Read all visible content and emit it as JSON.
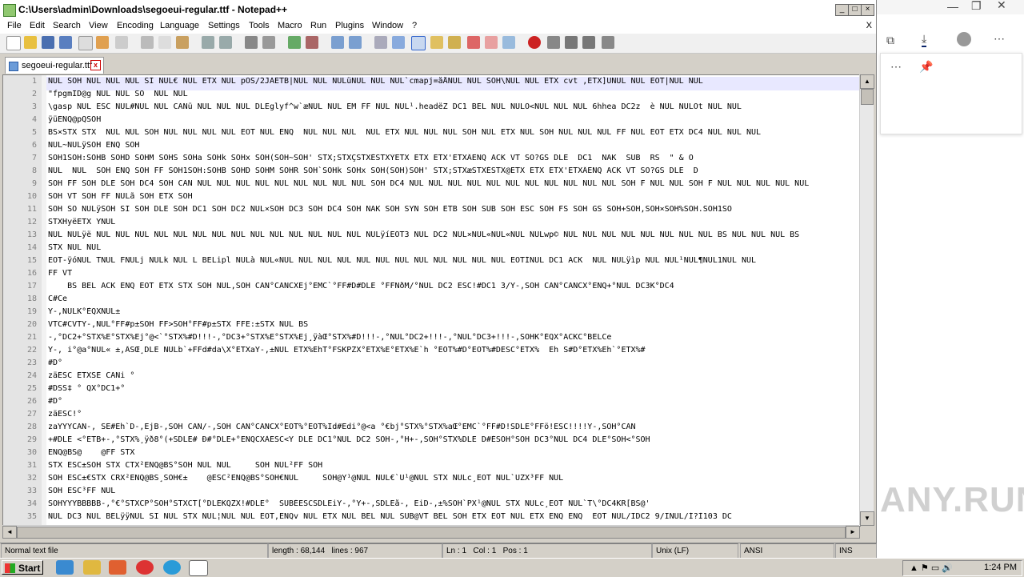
{
  "window": {
    "title": "C:\\Users\\admin\\Downloads\\segoeui-regular.ttf - Notepad++",
    "close_doc": "X"
  },
  "menu": [
    "File",
    "Edit",
    "Search",
    "View",
    "Encoding",
    "Language",
    "Settings",
    "Tools",
    "Macro",
    "Run",
    "Plugins",
    "Window",
    "?"
  ],
  "tab": {
    "label": "segoeui-regular.ttf",
    "close": "x"
  },
  "editor": {
    "line_numbers": [
      "1",
      "2",
      "3",
      "4",
      "5",
      "6",
      "7",
      "8",
      "9",
      "10",
      "11",
      "12",
      "13",
      "14",
      "15",
      "16",
      "17",
      "18",
      "19",
      "20",
      "21",
      "22",
      "23",
      "24",
      "25",
      "26",
      "27",
      "28",
      "29",
      "30",
      "31",
      "32",
      "33",
      "34",
      "35"
    ],
    "lines": [
      "NUL SOH NUL NUL NUL SI NUL€ NUL ETX NUL pOS/2JAETB|NUL NUL NULüNUL NUL NUL`cmapj=åÅNUL NUL SOH\\NUL NUL ETX cvt ,ETX]ÜNUL NUL EOT|NUL NUL",
      "\"fpgmID@g NUL NUL SO  NUL NUL",
      "\\gasp NUL ESC NUL#NUL NUL CANü NUL NUL NUL DLEglyf^w`æNUL NUL EM FF NUL NUL¹.headëZ DC1 BEL NUL NULÓ<NUL NUL NUL 6hhea DC2z  è NUL NULÒt NUL NUL",
      "ÿüENQ@pQSOH",
      "BS×STX STX  NUL NUL SOH NUL NUL NUL NUL EOT NUL ENQ  NUL NUL NUL  NUL ETX NUL NUL NUL SOH NUL ETX NUL SOH NUL NUL NUL FF NUL EOT ETX DC4 NUL NUL NUL",
      "NUL~NULÿSOH ENQ SOH",
      "SOH1SOH:SOHB SOHD SOHM SOHS SOHa SOHk SOHx SOH(SOH~SOH' STX;STXÇSTXÉSTXÝETX ETX ETX'ETXÂENQ ACK VT SO?GS DLE  DC1  NAK  SUB  RS  \" & O",
      "NUL  NUL  SOH ENQ SOH FF SOH1SOH:SOHB SOHD SOHM SOHR SOH`SOHk SOHx SOH(SOH)SOH' STX;STXæSTXÉSTX@ETX ETX ETX'ETXÂENQ ACK VT SO?GS DLE  D",
      "SOH FF SOH DLE SOH DC4 SOH CAN NUL NUL NUL NUL NUL NUL NUL NUL NUL SOH DC4 NUL NUL NUL NUL NUL NUL NUL NUL NUL NUL NUL SOH F NUL NUL SOH F NUL NUL NUL NUL NUL",
      "SOH VT SOH FF NULã SOH ETX SOH",
      "SOH SO NULÿSOH SI SOH DLE SOH DC1 SOH DC2 NUL×SOH DC3 SOH DC4 SOH NAK SOH SYN SOH ETB SOH SUB SOH ESC SOH FS SOH GS SOH+SOH,SOH×SOH%SOH.SOH1SO",
      "STXHyëETX YNUL",
      "NUL NULÿë NUL NUL NUL NUL NUL NUL NUL NUL NUL NUL NUL NUL NUL NUL NULÿíEOT3 NUL DC2 NUL×NUL«NUL«NUL NULwp© NUL NUL NUL NUL NUL NUL NUL NUL BS NUL NUL NUL BS",
      "STX NUL NUL",
      "EOT-ÿóNUL TNUL FNULj NULk NUL L BELipl NULà NUL«NUL NUL NUL NUL NUL NUL NUL NUL NUL NUL NUL NUL EOTÍNUL DC1 ACK  NUL NULÿìp NUL NUL¹NUL¶NUL1NUL NUL",
      "FF VT",
      "    BS BEL ACK ENQ EOT ETX STX SOH NUL,SOH CAN°CANCXEj°EMC`°FF#D#DLE °FFNðM/°NUL DC2 ESC!#DC1 3/Y-,SOH CAN°CANCX°ENQ+°NUL DC3K°DC4",
      "C#Ce",
      "Y-,NULK°ÈQXNUL±",
      "VTC#CVTY-,NUL°FF#p±SOH FF>SOH°FF#p±STX FFE:±STX NUL BS",
      "-,°DC2+°STX%E°STX%Ej°@<`°STX%#D!!!-,°DC3+°STX%E°STX%Ej¸ÿàŒ°STX%#D!!!-,°NUL°DC2+!!!-,°NUL°DC3+!!!-,SOHK°ÈQX°ACKC°BELCe",
      "Y-, i°@a°NUL« ±,ÂŠŒ¸DLE NULb`+FFd#da\\X°ETXaY-,±NUL ETX%EhT°FSKPZX°ETX%E°ETX%E`h °EOT%#D°EOT%#DESC°ETX%  Eh Š#D°ETX%Eh`°ETX%#",
      "#D°",
      "zäESC ETXŠE CANi °",
      "#DŠŠ‡ ° QX°DC1+°",
      "#D°",
      "zäESC!°",
      "zaYYYCAN-, ŠE#Eh`D-,EjB-,SOH CAN/-,SOH CAN°CANCX°EOT%°EOT%Id#Edi°@<a °€bj°STX%°STX%aŒ°EMC`°FF#D!ŠDLE°FFö!ESC!!!!Y-,SOH°CAN",
      "+#DLE <°ETB+-,°STX%¸ÿð8°(+ŠDLE# Ð#°DLE+°ENQCXÀESC<Y DLE DC1°NUL DC2 SOH-,°H+-,SOH°STX%DLE D#ÉSOH°SOH DC3°NUL DC4 DLE°SOH<°SOH",
      "ENQ@BS@    @FF STX",
      "STX ESC±SOH STX CTX²ENQ@BS°SOH NUL NUL     SOH NUL²FF SOH",
      "SOH ESC±€STX CRX²ENQ@BS¸SOH€±    @ESC²ENQ@BS°SOH€NUL     SOH@Y¹@NUL NUL€`U¹@NUL STX NULc¸EOT NUL`UZX³FF NUL",
      "SOH ESC³FF NUL",
      "SOHYYYBBBBB-,°€°STXCP°SOH°STXCT[°DLEKQZX!#DLE°  SUBÉESCŠDLEiY-,°Y+-,ŠDLEå-, EiD-,±%SOH`PX¹@NUL STX NULc¸EOT NUL`T\\°DC4KR[BS@'",
      "NUL DC3 NUL BELÿÿNUL SI NUL STX NUL¦NUL NUL EOT,ENQv NUL ETX NUL BEL NUL SUB@VT BEL SOH ETX EOT NUL ETX ENQ ENQ  EOT NUL/IDC2 9/INUL/Í?Ì103 DC"
    ]
  },
  "status": {
    "type": "Normal text file",
    "length": "length : 68,144",
    "lines": "lines : 967",
    "ln": "Ln : 1",
    "col": "Col : 1",
    "pos": "Pos : 1",
    "eol": "Unix (LF)",
    "enc": "ANSI",
    "ins": "INS"
  },
  "taskbar": {
    "start": "Start",
    "clock": "1:24 PM"
  },
  "watermark": "ANY.RUN",
  "colors": {
    "accent": "#0a246a",
    "edge_panel_bg": "#ffffff",
    "current_line": "#e8e8ff"
  }
}
